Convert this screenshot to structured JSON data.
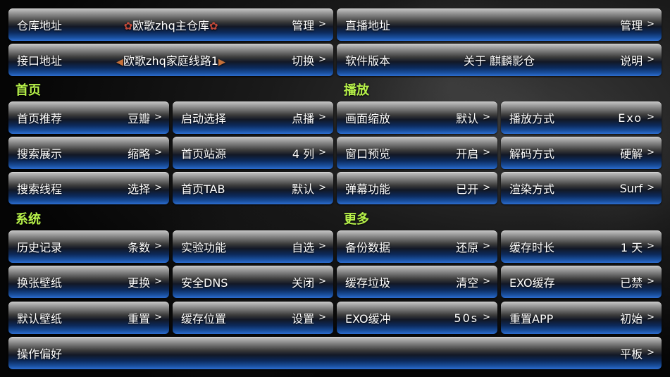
{
  "top": {
    "warehouse": {
      "label": "仓库地址",
      "center": "欧歌zhq主仓库",
      "action": "管理",
      "center_icon": "rose-icon"
    },
    "live": {
      "label": "直播地址",
      "action": "管理"
    },
    "api": {
      "label": "接口地址",
      "center": "欧歌zhq家庭线路1",
      "action": "切换",
      "center_icon": "horn-icon"
    },
    "version": {
      "label": "软件版本",
      "center": "关于 麒麟影仓",
      "action": "说明"
    }
  },
  "sections": {
    "home": "首页",
    "play": "播放",
    "system": "系统",
    "more": "更多"
  },
  "home": [
    {
      "label": "首页推荐",
      "value": "豆瓣"
    },
    {
      "label": "启动选择",
      "value": "点播"
    },
    {
      "label": "搜索展示",
      "value": "缩略"
    },
    {
      "label": "首页站源",
      "value": "4 列"
    },
    {
      "label": "搜索线程",
      "value": "选择"
    },
    {
      "label": "首页TAB",
      "value": "默认"
    }
  ],
  "play": [
    {
      "label": "画面缩放",
      "value": "默认"
    },
    {
      "label": "播放方式",
      "value": "Exo"
    },
    {
      "label": "窗口预览",
      "value": "开启"
    },
    {
      "label": "解码方式",
      "value": "硬解"
    },
    {
      "label": "弹幕功能",
      "value": "已开"
    },
    {
      "label": "渲染方式",
      "value": "Surf"
    }
  ],
  "system": [
    {
      "label": "历史记录",
      "value": "条数"
    },
    {
      "label": "实验功能",
      "value": "自选"
    },
    {
      "label": "换张壁纸",
      "value": "更换"
    },
    {
      "label": "安全DNS",
      "value": "关闭"
    },
    {
      "label": "默认壁纸",
      "value": "重置"
    },
    {
      "label": "缓存位置",
      "value": "设置"
    }
  ],
  "more": [
    {
      "label": "备份数据",
      "value": "还原"
    },
    {
      "label": "缓存时长",
      "value": "1 天"
    },
    {
      "label": "缓存垃圾",
      "value": "清空"
    },
    {
      "label": "EXO缓存",
      "value": "已禁"
    },
    {
      "label": "EXO缓冲",
      "value": "50s"
    },
    {
      "label": "重置APP",
      "value": "初始"
    }
  ],
  "bottom": {
    "label": "操作偏好",
    "value": "平板"
  },
  "chevron": ">",
  "colors": {
    "heading": "#b7f24a",
    "tile_blue": "#1a4f9e",
    "tile_gray": "#8a8a8a"
  }
}
